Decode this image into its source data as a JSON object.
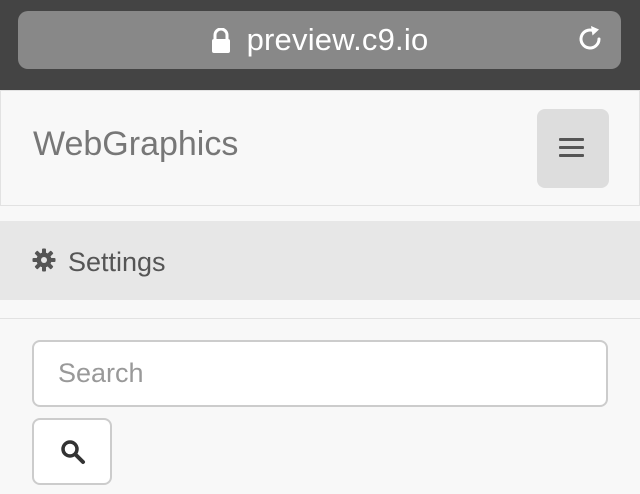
{
  "browser": {
    "url": "preview.c9.io",
    "lock_icon": "lock-icon",
    "reload_icon": "reload-icon",
    "bar_color": "#444444",
    "pill_color": "#888888"
  },
  "navbar": {
    "brand": "WebGraphics",
    "toggle_icon": "hamburger-menu-icon"
  },
  "menu": {
    "settings_label": "Settings",
    "settings_icon": "gear-icon"
  },
  "search": {
    "placeholder": "Search",
    "value": "",
    "button_icon": "search-icon"
  }
}
